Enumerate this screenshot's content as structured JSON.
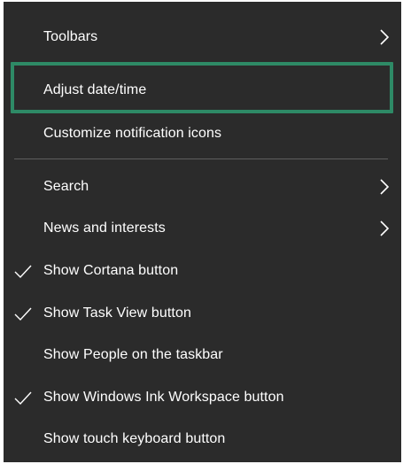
{
  "colors": {
    "menu_background": "#2b2b2b",
    "text": "#ffffff",
    "separator": "#5e5e5e",
    "highlight_border": "#2e8a66"
  },
  "menu": {
    "items": [
      {
        "label": "Toolbars",
        "checked": false,
        "submenu": true
      },
      {
        "label": "Adjust date/time",
        "checked": false,
        "submenu": false,
        "highlighted": true
      },
      {
        "label": "Customize notification icons",
        "checked": false,
        "submenu": false
      },
      {
        "label": "Search",
        "checked": false,
        "submenu": true
      },
      {
        "label": "News and interests",
        "checked": false,
        "submenu": true
      },
      {
        "label": "Show Cortana button",
        "checked": true,
        "submenu": false
      },
      {
        "label": "Show Task View button",
        "checked": true,
        "submenu": false
      },
      {
        "label": "Show People on the taskbar",
        "checked": false,
        "submenu": false
      },
      {
        "label": "Show Windows Ink Workspace button",
        "checked": true,
        "submenu": false
      },
      {
        "label": "Show touch keyboard button",
        "checked": false,
        "submenu": false
      }
    ]
  },
  "icons": {
    "check": "checkmark-icon",
    "submenu": "chevron-right-icon"
  }
}
